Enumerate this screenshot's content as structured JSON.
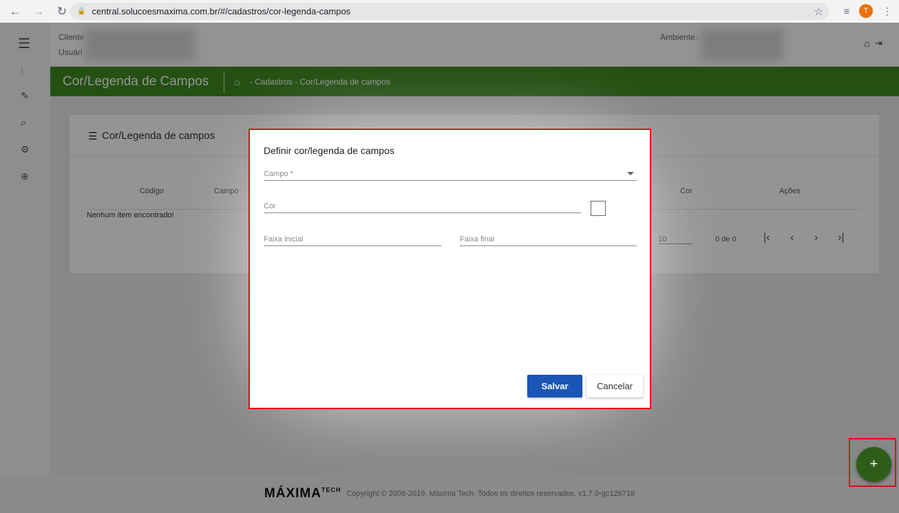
{
  "browser": {
    "url": "central.solucoesmaxima.com.br/#/cadastros/cor-legenda-campos",
    "avatar": "T"
  },
  "header": {
    "cliente_label": "Cliente",
    "usuario_label": "Usuári",
    "ambiente_label": "Ambiente:"
  },
  "greenbar": {
    "title": "Cor/Legenda de Campos",
    "breadcrumb": "- Cadastros - Cor/Legenda de campos"
  },
  "card": {
    "title": "Cor/Legenda de campos",
    "columns": [
      "Código",
      "Campo",
      "Cor",
      "Ações"
    ],
    "empty": "Nenhum item encontrado!",
    "page_size": "10",
    "range": "0 de 0"
  },
  "dialog": {
    "title": "Definir cor/legenda de campos",
    "campo_label": "Campo *",
    "cor_label": "Cor",
    "faixa_inicial_label": "Faixa inicial",
    "faixa_final_label": "Faixa final",
    "save": "Salvar",
    "cancel": "Cancelar"
  },
  "footer": {
    "logo": "MÁXIMA",
    "logo_sup": "TECH",
    "copyright": "Copyright © 2008-2019. Máxima Tech. Todos os direitos reservados. v1.7.0-gc126718"
  },
  "fab": "+"
}
